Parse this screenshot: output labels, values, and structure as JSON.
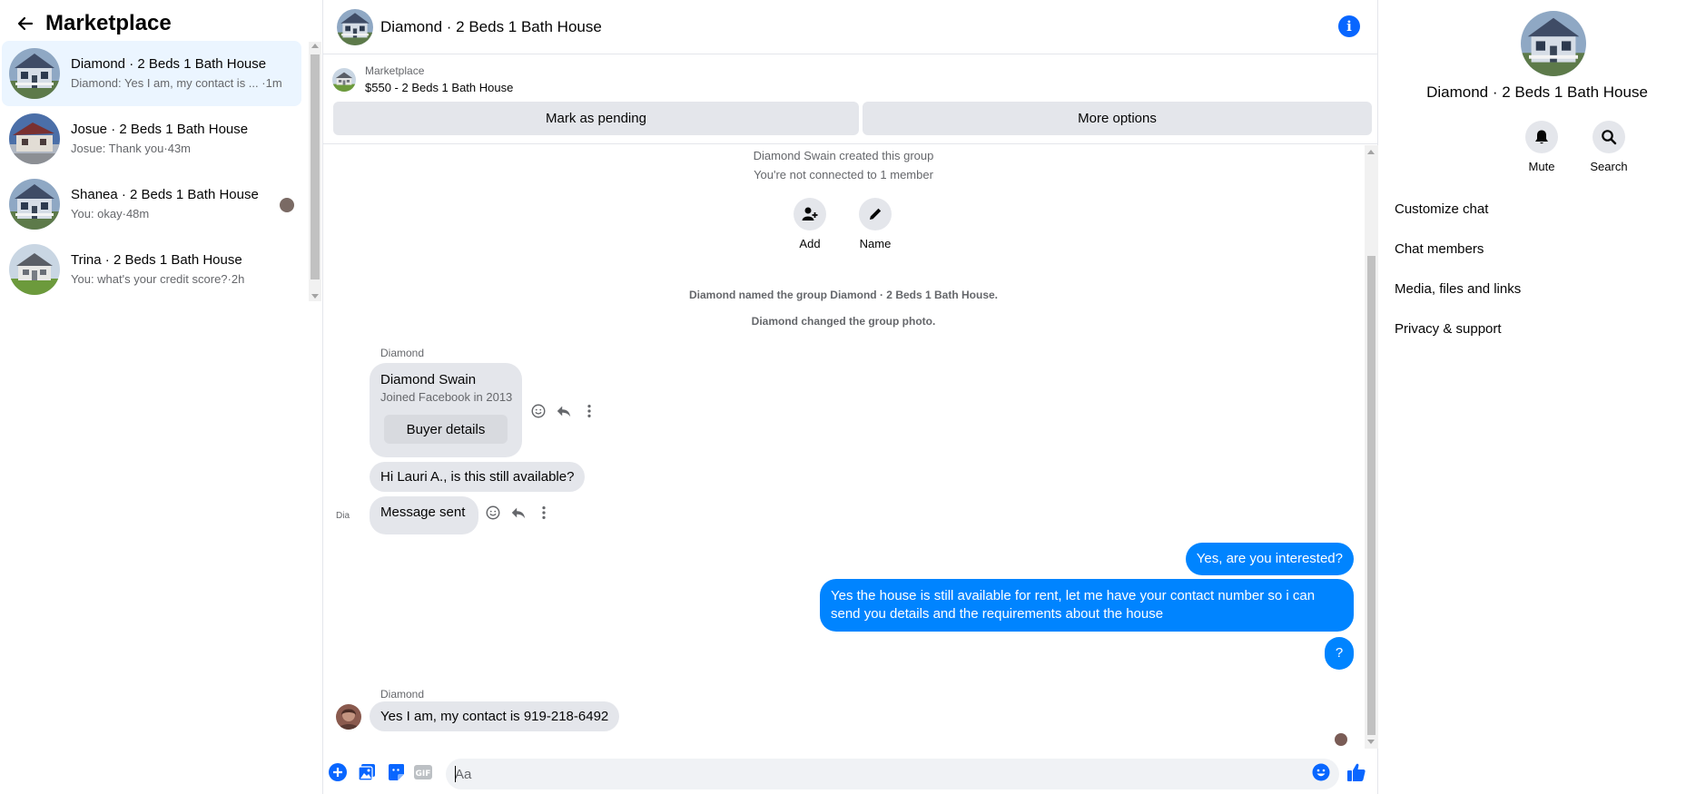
{
  "left": {
    "title": "Marketplace",
    "conversations": [
      {
        "name": "Diamond · 2 Beds 1 Bath House",
        "preview": "Diamond: Yes I am, my contact is ... ·1m"
      },
      {
        "name": "Josue · 2 Beds 1 Bath House",
        "preview": "Josue: Thank you·43m"
      },
      {
        "name": "Shanea · 2 Beds 1 Bath House",
        "preview": "You: okay·48m"
      },
      {
        "name": "Trina · 2 Beds 1 Bath House",
        "preview": "You: what's your credit score?·2h"
      }
    ]
  },
  "chat": {
    "title": "Diamond · 2 Beds 1 Bath House",
    "marketplace_label": "Marketplace",
    "listing": "$550 - 2 Beds 1 Bath House",
    "mark_pending": "Mark as pending",
    "more_options": "More options",
    "created_text": "Diamond Swain created this group",
    "not_connected": "You're not connected to 1 member",
    "add_label": "Add",
    "name_label": "Name",
    "named_event": "Diamond named the group Diamond · 2 Beds 1 Bath House.",
    "photo_event": "Diamond changed the group photo.",
    "sender_1": "Diamond",
    "card_name": "Diamond Swain",
    "card_sub": "Joined Facebook in 2013",
    "card_button": "Buyer details",
    "msg_available": "Hi Lauri A., is this still available?",
    "msg_sent": "Message sent",
    "broken_avatar_alt": "Dia",
    "out_1": "Yes, are you interested?",
    "out_2": "Yes the house is still available for rent, let me have your contact number so i can send you details and the requirements about the house",
    "out_3": "?",
    "sender_2": "Diamond",
    "msg_contact": "Yes I am, my contact is 919-218-6492",
    "composer_placeholder": "Aa"
  },
  "right": {
    "name": "Diamond · 2 Beds 1 Bath House",
    "mute": "Mute",
    "search": "Search",
    "menu": [
      "Customize chat",
      "Chat members",
      "Media, files and links",
      "Privacy & support"
    ]
  },
  "colors": {
    "accent": "#0084ff",
    "icon_blue": "#0866ff",
    "bubble_in": "#e4e6eb",
    "active_bg": "#ebf5ff"
  }
}
